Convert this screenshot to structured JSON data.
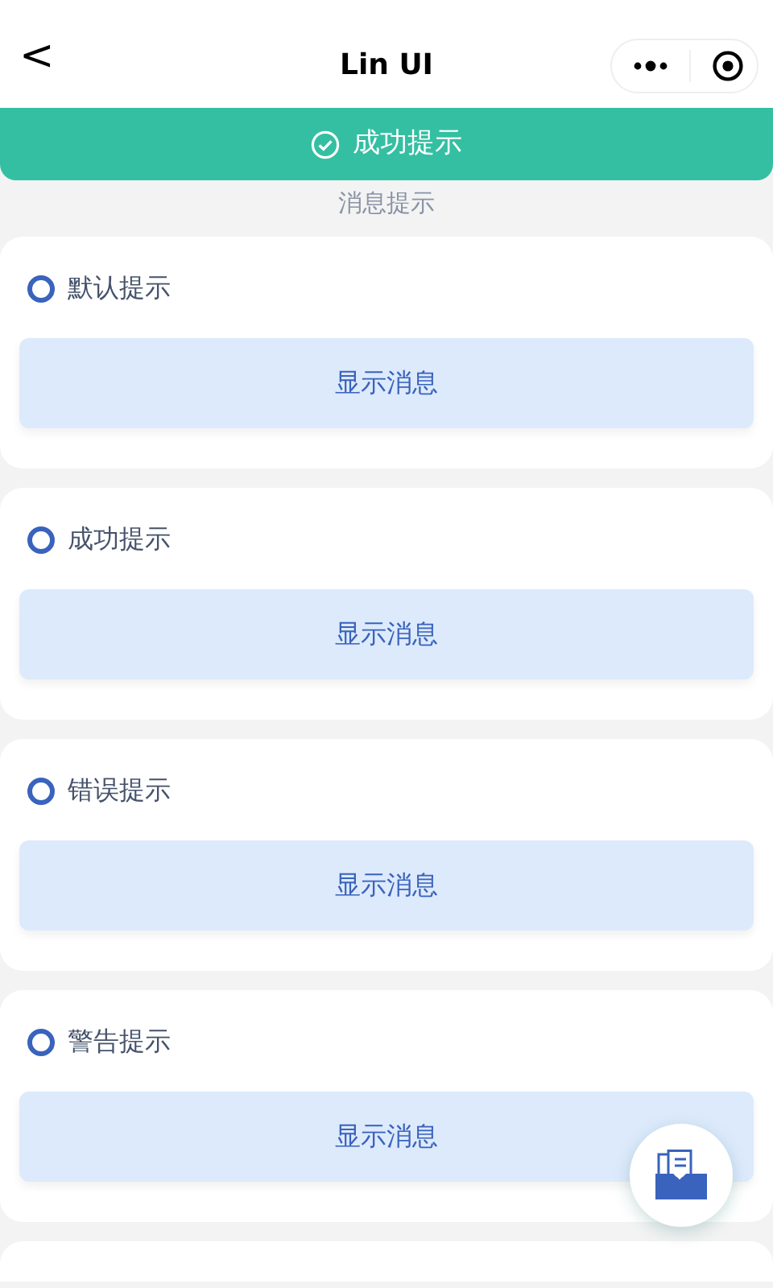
{
  "nav": {
    "back": "<",
    "title": "Lin UI"
  },
  "toast": {
    "kind": "success",
    "text": "成功提示"
  },
  "page_title": "消息提示",
  "sections": [
    {
      "title": "默认提示",
      "button": "显示消息"
    },
    {
      "title": "成功提示",
      "button": "显示消息"
    },
    {
      "title": "错误提示",
      "button": "显示消息"
    },
    {
      "title": "警告提示",
      "button": "显示消息"
    }
  ],
  "has_more_section": true
}
